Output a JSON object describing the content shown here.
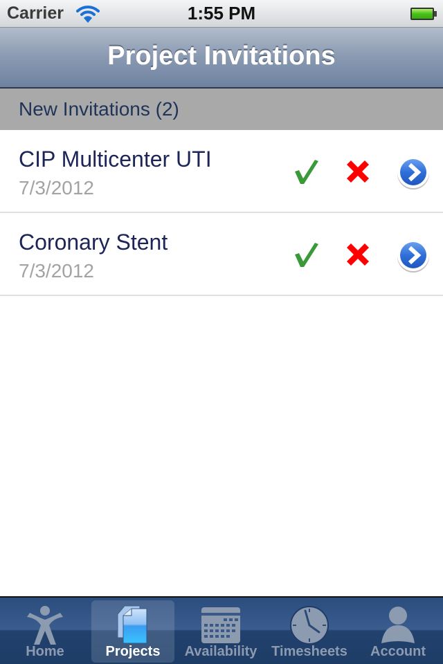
{
  "status_bar": {
    "carrier": "Carrier",
    "time": "1:55 PM",
    "wifi_icon": "wifi-icon",
    "battery_icon": "battery-full-icon"
  },
  "nav_bar": {
    "title": "Project Invitations"
  },
  "section": {
    "title": "New Invitations (2)"
  },
  "invitations": [
    {
      "title": "CIP Multicenter UTI",
      "date": "7/3/2012",
      "accept_icon": "checkmark-icon",
      "decline_icon": "x-icon",
      "detail_icon": "disclosure-arrow-icon"
    },
    {
      "title": "Coronary Stent",
      "date": "7/3/2012",
      "accept_icon": "checkmark-icon",
      "decline_icon": "x-icon",
      "detail_icon": "disclosure-arrow-icon"
    }
  ],
  "tab_bar": {
    "selected": "Projects",
    "tabs": [
      {
        "label": "Home",
        "icon": "person-figure-icon"
      },
      {
        "label": "Projects",
        "icon": "documents-icon"
      },
      {
        "label": "Availability",
        "icon": "calendar-icon"
      },
      {
        "label": "Timesheets",
        "icon": "clock-icon"
      },
      {
        "label": "Account",
        "icon": "user-icon"
      }
    ]
  },
  "colors": {
    "accept": "#3a9a3a",
    "decline": "#ff0000",
    "detail": "#2f6fd8",
    "title_text": "#1d2557",
    "date_text": "#a3a3a3"
  }
}
